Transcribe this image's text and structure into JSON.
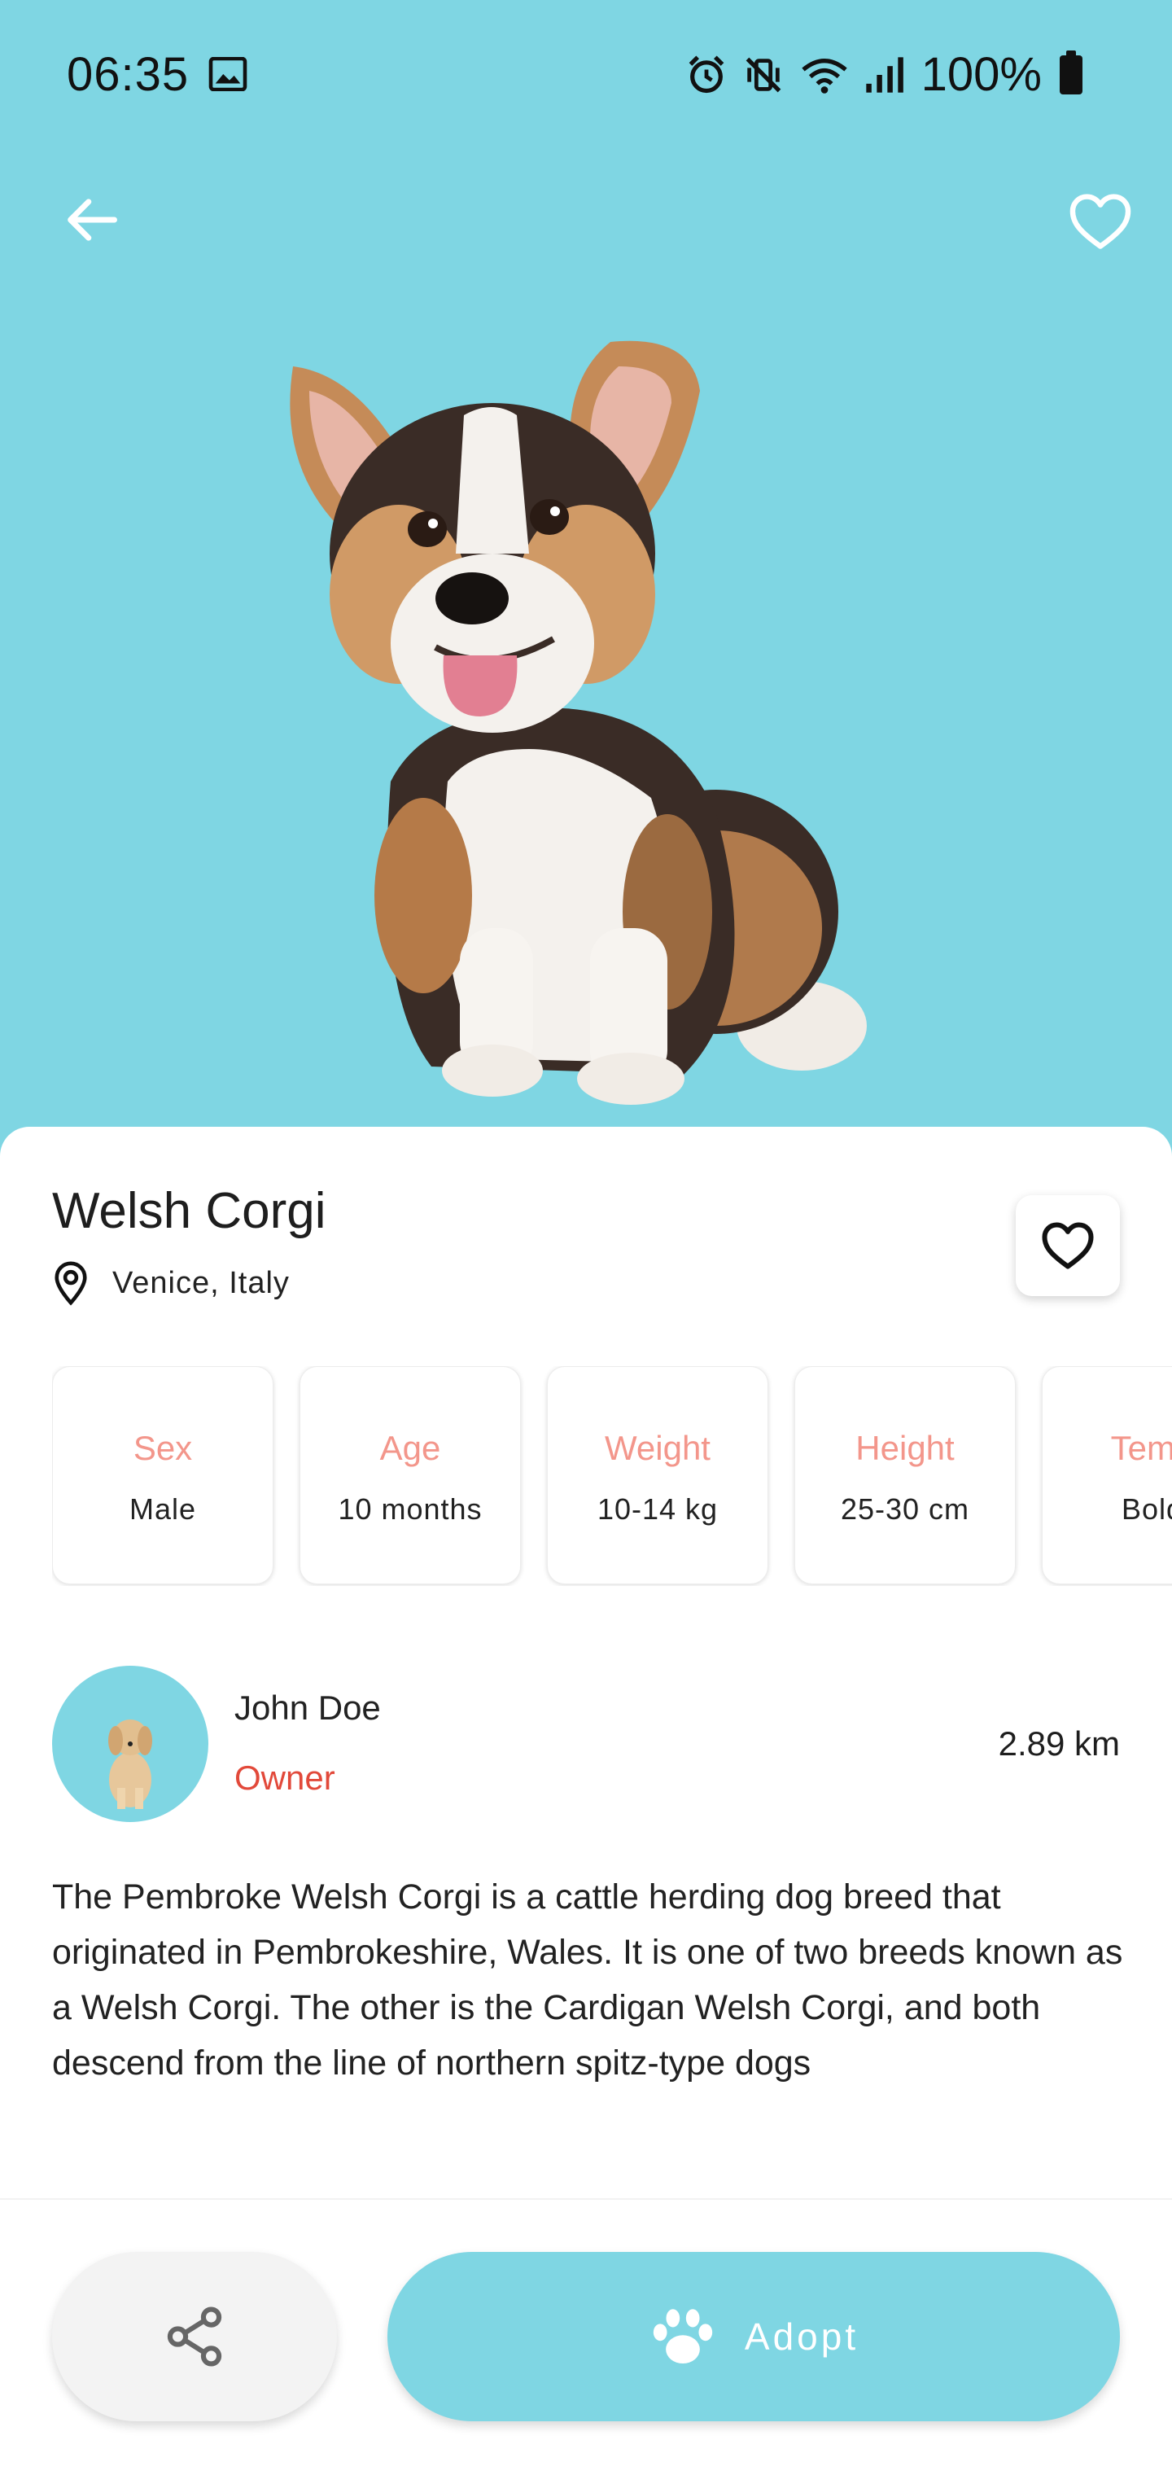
{
  "status_bar": {
    "time": "06:35",
    "battery": "100%",
    "icons": [
      "image-icon",
      "alarm-icon",
      "vibrate-off-icon",
      "wifi-icon",
      "signal-icon",
      "battery-icon"
    ]
  },
  "colors": {
    "accent": "#7fd6e3",
    "label": "#f3968b",
    "owner_role": "#e2493a",
    "text": "#222222"
  },
  "pet": {
    "name": "Welsh Corgi",
    "location": "Venice, Italy"
  },
  "stats": [
    {
      "label": "Sex",
      "value": "Male"
    },
    {
      "label": "Age",
      "value": "10 months"
    },
    {
      "label": "Weight",
      "value": "10-14 kg"
    },
    {
      "label": "Height",
      "value": "25-30 cm"
    },
    {
      "label": "Temp",
      "value": "Bold"
    }
  ],
  "owner": {
    "name": "John Doe",
    "role": "Owner",
    "distance": "2.89 km"
  },
  "description": "The Pembroke Welsh Corgi is a cattle herding dog breed that originated in Pembrokeshire, Wales. It is one of two breeds known as a Welsh Corgi. The other is the Cardigan Welsh Corgi, and both descend from the line of northern spitz-type dogs",
  "actions": {
    "adopt_label": "Adopt"
  }
}
